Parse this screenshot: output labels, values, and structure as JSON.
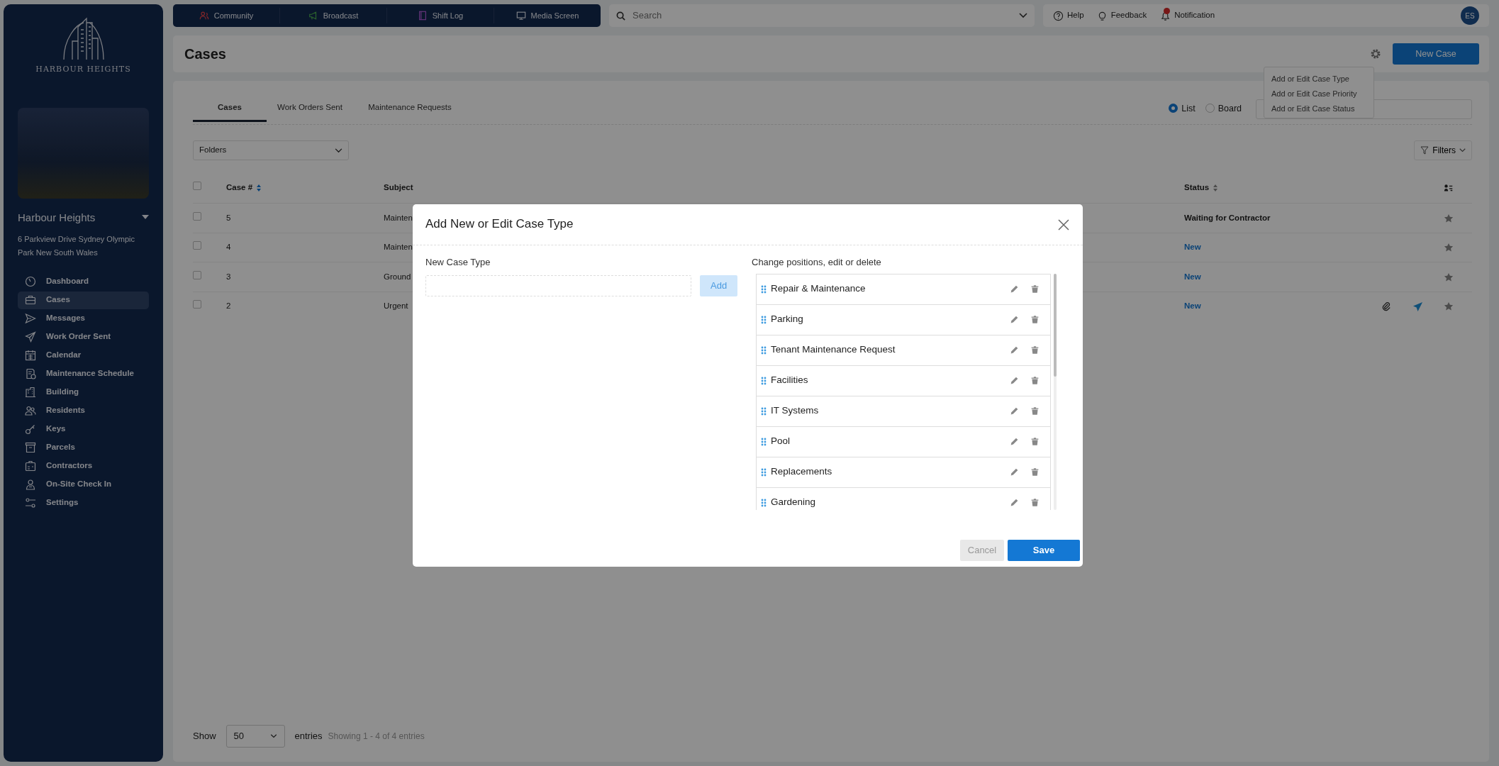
{
  "sidebar": {
    "logo_text": "HARBOUR HEIGHTS",
    "property_name": "Harbour Heights",
    "address": "6 Parkview Drive Sydney Olympic Park New South Wales",
    "items": [
      {
        "label": "Dashboard",
        "selected": false
      },
      {
        "label": "Cases",
        "selected": true
      },
      {
        "label": "Messages",
        "selected": false
      },
      {
        "label": "Work Order Sent",
        "selected": false
      },
      {
        "label": "Calendar",
        "selected": false
      },
      {
        "label": "Maintenance Schedule",
        "selected": false
      },
      {
        "label": "Building",
        "selected": false
      },
      {
        "label": "Residents",
        "selected": false
      },
      {
        "label": "Keys",
        "selected": false
      },
      {
        "label": "Parcels",
        "selected": false
      },
      {
        "label": "Contractors",
        "selected": false
      },
      {
        "label": "On-Site Check In",
        "selected": false
      },
      {
        "label": "Settings",
        "selected": false
      }
    ]
  },
  "top_nav": [
    {
      "label": "Community"
    },
    {
      "label": "Broadcast"
    },
    {
      "label": "Shift Log"
    },
    {
      "label": "Media Screen"
    }
  ],
  "search": {
    "placeholder": "Search"
  },
  "header_links": [
    {
      "label": "Help"
    },
    {
      "label": "Feedback"
    },
    {
      "label": "Notification"
    }
  ],
  "avatar": "ES",
  "page": {
    "title": "Cases",
    "new_button": "New Case"
  },
  "settings_menu": [
    "Add or Edit Case Type",
    "Add or Edit Case Priority",
    "Add or Edit Case Status"
  ],
  "tabs": [
    {
      "label": "Cases",
      "selected": true
    },
    {
      "label": "Work Orders Sent",
      "selected": false
    },
    {
      "label": "Maintenance Requests",
      "selected": false
    }
  ],
  "view_options": [
    {
      "label": "List",
      "selected": true
    },
    {
      "label": "Board",
      "selected": false
    }
  ],
  "folders": {
    "label": "Folders"
  },
  "filters_button": "Filters",
  "table": {
    "columns": [
      "Case #",
      "Subject",
      "Status"
    ],
    "all_checked": false,
    "rows": [
      {
        "case": "5",
        "subject": "Mainten",
        "status": "Waiting for Contractor",
        "kind": "waiting",
        "checked": false,
        "starred": false
      },
      {
        "case": "4",
        "subject": "Mainten",
        "status": "New",
        "kind": "new",
        "checked": false,
        "starred": false
      },
      {
        "case": "3",
        "subject": "Ground",
        "status": "New",
        "kind": "new",
        "checked": false,
        "starred": false
      },
      {
        "case": "2",
        "subject": "Urgent",
        "status": "New",
        "kind": "new",
        "checked": false,
        "attachment": true,
        "sent": true,
        "starred": false
      }
    ]
  },
  "footer": {
    "show": "Show",
    "page_size": "50",
    "entries": "entries",
    "info": "Showing 1 - 4 of 4 entries"
  },
  "modal": {
    "title": "Add New or Edit Case Type",
    "new_label": "New Case Type",
    "add_button": "Add",
    "list_label": "Change positions, edit or delete",
    "items": [
      "Repair & Maintenance",
      "Parking",
      "Tenant Maintenance Request",
      "Facilities",
      "IT Systems",
      "Pool",
      "Replacements",
      "Gardening"
    ],
    "cancel": "Cancel",
    "save": "Save"
  }
}
